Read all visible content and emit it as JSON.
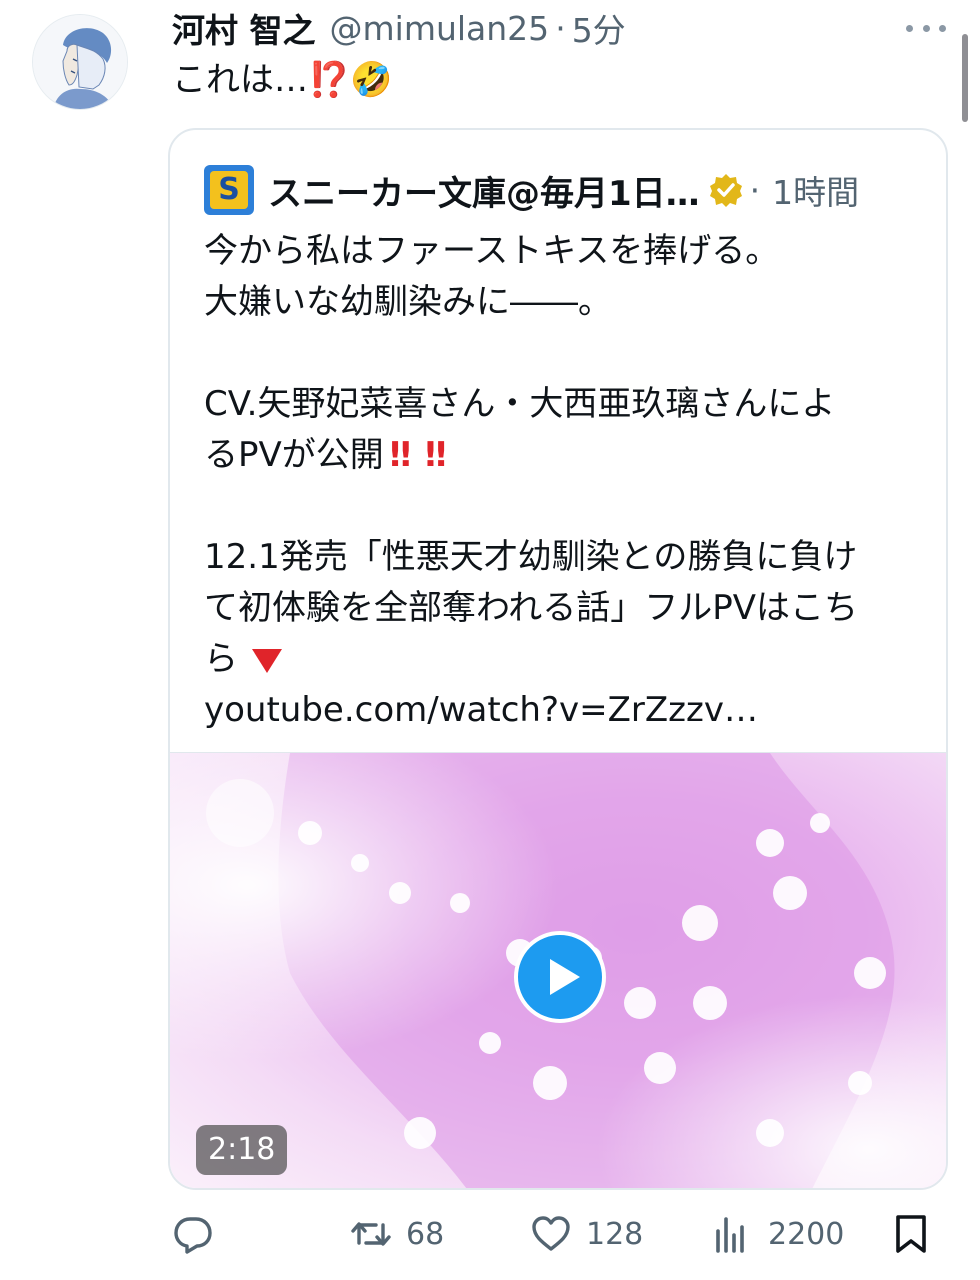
{
  "tweet": {
    "author_name": "河村 智之",
    "handle": "@mimulan25",
    "separator": "·",
    "time": "5分",
    "text": "これは…",
    "text_emoji": "⁉️",
    "text_emoji2": "🤣"
  },
  "quote": {
    "logo_letter": "S",
    "author_name": "スニーカー文庫@毎月1日…",
    "separator": "·",
    "time": "1時間",
    "lines": [
      "今から私はファーストキスを捧げる。",
      "大嫌いな幼馴染みに――。",
      "",
      "CV.矢野妃菜喜さん・大西亜玖璃さんによ",
      "るPVが公開",
      "",
      "12.1発売「性悪天才幼馴染との勝負に負け",
      "て初体験を全部奪われる話」フルPVはこち",
      "ら",
      "youtube.com/watch?v=ZrZzzv…"
    ],
    "bang": "‼",
    "media": {
      "duration": "2:18"
    }
  },
  "actions": {
    "retweets": "68",
    "likes": "128",
    "views": "2200"
  },
  "colors": {
    "accent": "#1d9bf0",
    "muted": "#536471",
    "emoji_red": "#e0242a"
  },
  "icons": [
    "more-icon",
    "verified-badge-icon",
    "play-icon",
    "reply-icon",
    "retweet-icon",
    "like-icon",
    "views-icon",
    "bookmark-icon"
  ]
}
